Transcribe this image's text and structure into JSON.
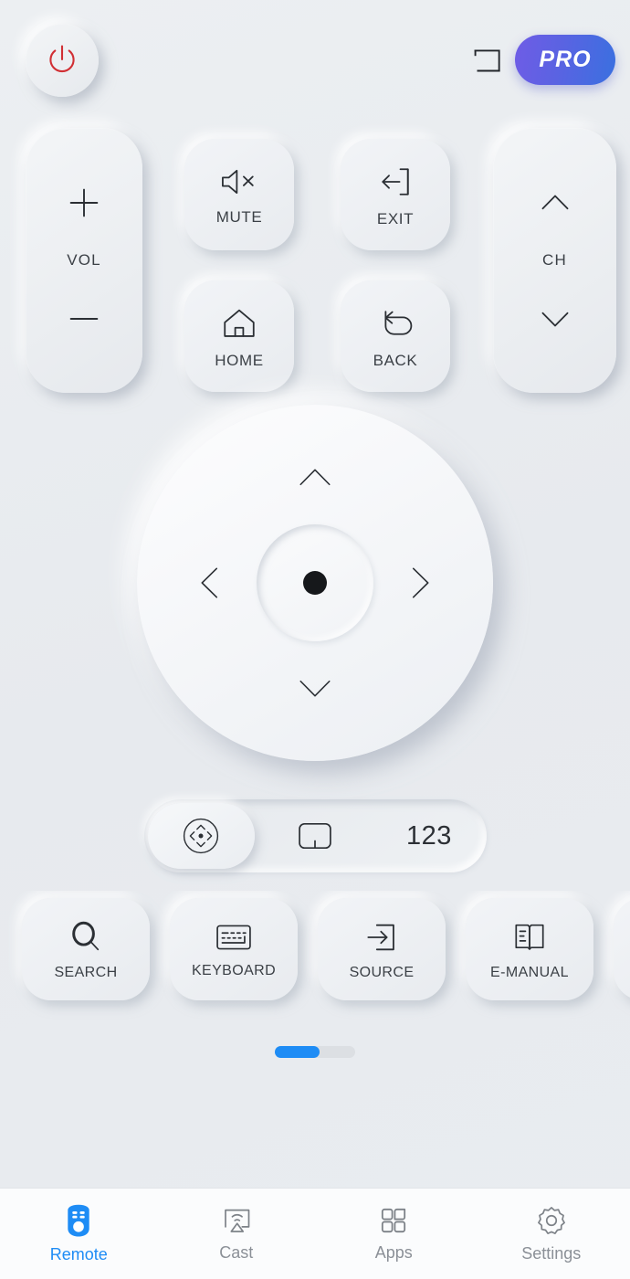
{
  "app": {
    "background": "#e9ecef",
    "accent": "#1e8cf5"
  },
  "topbar": {
    "power": {
      "label": "Power",
      "icon": "power-icon",
      "color": "#d12f34"
    },
    "screen": {
      "label": "Screen Mirror",
      "icon": "frame-corner-icon"
    },
    "pro": {
      "label": "PRO",
      "gradient_from": "#6f5ce6",
      "gradient_to": "#3a70e0"
    }
  },
  "cluster": {
    "volume": {
      "label": "VOL",
      "up_icon": "plus-icon",
      "down_icon": "minus-icon"
    },
    "channel": {
      "label": "CH",
      "up_icon": "chevron-up-icon",
      "down_icon": "chevron-down-icon"
    },
    "buttons": [
      {
        "id": "mute",
        "label": "MUTE",
        "icon": "speaker-mute-icon"
      },
      {
        "id": "exit",
        "label": "EXIT",
        "icon": "exit-icon"
      },
      {
        "id": "home",
        "label": "HOME",
        "icon": "home-icon"
      },
      {
        "id": "back",
        "label": "BACK",
        "icon": "back-arrow-icon"
      }
    ]
  },
  "dpad": {
    "up": "chevron-up-icon",
    "down": "chevron-down-icon",
    "left": "chevron-left-icon",
    "right": "chevron-right-icon",
    "ok": {
      "label": "OK",
      "icon": "center-dot-icon"
    }
  },
  "mode_switch": {
    "selected": "dpad",
    "options": [
      {
        "id": "dpad",
        "label": "",
        "icon": "dpad-circle-icon",
        "active": true
      },
      {
        "id": "touchpad",
        "label": "",
        "icon": "touchpad-icon",
        "active": false
      },
      {
        "id": "numbers",
        "label": "123",
        "icon": "",
        "active": false
      }
    ]
  },
  "functions": [
    {
      "id": "search",
      "label": "SEARCH",
      "icon": "search-icon"
    },
    {
      "id": "keyboard",
      "label": "KEYBOARD",
      "icon": "keyboard-icon"
    },
    {
      "id": "source",
      "label": "SOURCE",
      "icon": "source-input-icon"
    },
    {
      "id": "emanual",
      "label": "E-MANUAL",
      "icon": "book-icon"
    },
    {
      "id": "more",
      "label": "",
      "icon": ""
    }
  ],
  "scroll": {
    "progress": 56
  },
  "navbar": {
    "items": [
      {
        "id": "remote",
        "label": "Remote",
        "icon": "remote-icon",
        "active": true
      },
      {
        "id": "cast",
        "label": "Cast",
        "icon": "cast-icon",
        "active": false
      },
      {
        "id": "apps",
        "label": "Apps",
        "icon": "apps-grid-icon",
        "active": false
      },
      {
        "id": "settings",
        "label": "Settings",
        "icon": "gear-icon",
        "active": false
      }
    ]
  }
}
